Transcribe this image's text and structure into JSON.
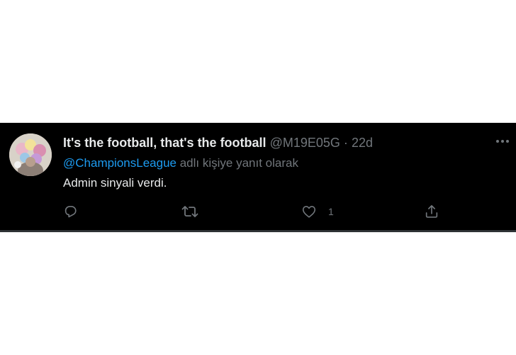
{
  "tweet": {
    "display_name": "It's the football, that's the football",
    "handle": "@M19E05G",
    "separator": "·",
    "time": "22d",
    "reply_mention": "@ChampionsLeague",
    "reply_suffix": "adlı kişiye yanıt olarak",
    "text": "Admin sinyali verdi.",
    "actions": {
      "reply_icon": "reply-icon",
      "retweet_icon": "retweet-icon",
      "like_icon": "heart-icon",
      "like_count": "1",
      "share_icon": "share-icon"
    },
    "colors": {
      "background": "#000000",
      "primary_text": "#e7e9ea",
      "secondary_text": "#71767b",
      "link": "#1d9bf0"
    }
  }
}
